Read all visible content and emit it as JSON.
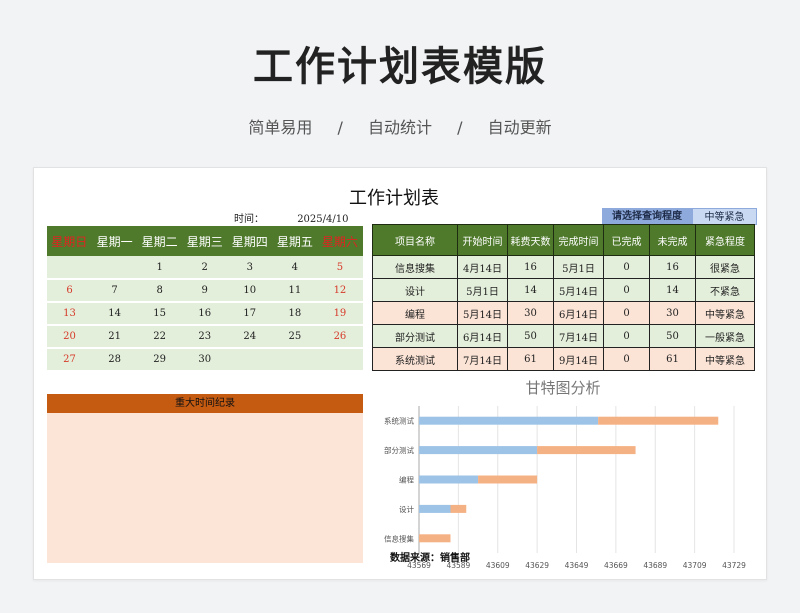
{
  "hero": {
    "title": "工作计划表模版",
    "tags": [
      "简单易用",
      "自动统计",
      "自动更新"
    ],
    "separator": "/"
  },
  "sheet": {
    "title": "工作计划表",
    "time_label": "时间：",
    "time_value": "2025/4/10",
    "query_label": "请选择查询程度",
    "query_value": "中等紧急"
  },
  "calendar": {
    "weekdays": [
      "星期日",
      "星期一",
      "星期二",
      "星期三",
      "星期四",
      "星期五",
      "星期六"
    ],
    "weeks": [
      [
        "",
        "",
        "1",
        "2",
        "3",
        "4",
        "5"
      ],
      [
        "6",
        "7",
        "8",
        "9",
        "10",
        "11",
        "12"
      ],
      [
        "13",
        "14",
        "15",
        "16",
        "17",
        "18",
        "19"
      ],
      [
        "20",
        "21",
        "22",
        "23",
        "24",
        "25",
        "26"
      ],
      [
        "27",
        "28",
        "29",
        "30",
        "",
        "",
        ""
      ]
    ],
    "weekend_color": "#e0241f"
  },
  "tasks": {
    "headers": [
      "项目名称",
      "开始时间",
      "耗费天数",
      "完成时间",
      "已完成",
      "未完成",
      "紧急程度"
    ],
    "rows": [
      [
        "信息搜集",
        "4月14日",
        "16",
        "5月1日",
        "0",
        "16",
        "很紧急"
      ],
      [
        "设计",
        "5月1日",
        "14",
        "5月14日",
        "0",
        "14",
        "不紧急"
      ],
      [
        "编程",
        "5月14日",
        "30",
        "6月14日",
        "0",
        "30",
        "中等紧急"
      ],
      [
        "部分测试",
        "6月14日",
        "50",
        "7月14日",
        "0",
        "50",
        "一般紧急"
      ],
      [
        "系统测试",
        "7月14日",
        "61",
        "9月14日",
        "0",
        "61",
        "中等紧急"
      ]
    ],
    "row_styles": [
      "g",
      "g",
      "p",
      "g",
      "p"
    ]
  },
  "records": {
    "title": "重大时间纪录"
  },
  "chart_data": {
    "type": "bar",
    "orientation": "horizontal-stacked",
    "title": "甘特图分析",
    "categories": [
      "信息搜集",
      "设计",
      "编程",
      "部分测试",
      "系统测试"
    ],
    "series": [
      {
        "values": [
          43569,
          43585,
          43599,
          43629,
          43660
        ],
        "color": "#9dc3e6"
      },
      {
        "values": [
          16,
          8,
          30,
          50,
          61
        ],
        "color": "#f4b183"
      }
    ],
    "xlim": [
      43569,
      43729
    ],
    "xticks": [
      "43569",
      "43589",
      "43609",
      "43629",
      "43649",
      "43669",
      "43689",
      "43709",
      "43729"
    ],
    "grid": true,
    "source_label": "数据来源：销售部"
  }
}
